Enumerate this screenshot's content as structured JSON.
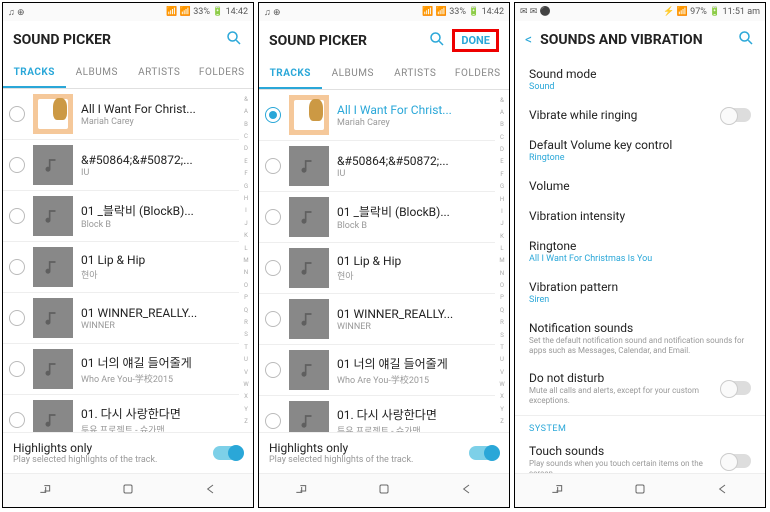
{
  "status1": {
    "left": "♫ ⊕",
    "right": "📶 📶 33% 🔋 14:42"
  },
  "status3": {
    "left": "✉ ✉ ⚫",
    "right": "⚡ 📶 97% 🔋 11:51 am"
  },
  "screen1": {
    "title": "SOUND PICKER",
    "tabs": [
      "TRACKS",
      "ALBUMS",
      "ARTISTS",
      "FOLDERS"
    ],
    "tracks": [
      {
        "title": "All I Want For Christ...",
        "artist": "Mariah Carey",
        "cover": true,
        "selected": false
      },
      {
        "title": "&#50864;&#50872;...",
        "artist": "IU"
      },
      {
        "title": "01 _블락비 (BlockB)...",
        "artist": "Block B"
      },
      {
        "title": "01 Lip & Hip",
        "artist": "현아"
      },
      {
        "title": "01 WINNER_REALLY...",
        "artist": "WINNER"
      },
      {
        "title": "01 너의 얘길 들어줄게",
        "artist": "Who Are You-学校2015"
      },
      {
        "title": "01. 다시 사랑한다면",
        "artist": "투유 프로젝트 - 슈가맨"
      }
    ],
    "highlights_title": "Highlights only",
    "highlights_sub": "Play selected highlights of the track."
  },
  "screen2": {
    "title": "SOUND PICKER",
    "done": "DONE",
    "tabs": [
      "TRACKS",
      "ALBUMS",
      "ARTISTS",
      "FOLDERS"
    ],
    "tracks": [
      {
        "title": "All I Want For Christ...",
        "artist": "Mariah Carey",
        "cover": true,
        "selected": true
      },
      {
        "title": "&#50864;&#50872;...",
        "artist": "IU"
      },
      {
        "title": "01 _블락비 (BlockB)...",
        "artist": "Block B"
      },
      {
        "title": "01 Lip & Hip",
        "artist": "현아"
      },
      {
        "title": "01 WINNER_REALLY...",
        "artist": "WINNER"
      },
      {
        "title": "01 너의 얘길 들어줄게",
        "artist": "Who Are You-学校2015"
      },
      {
        "title": "01. 다시 사랑한다면",
        "artist": "투유 프로젝트 - 슈가맨"
      }
    ],
    "highlights_title": "Highlights only",
    "highlights_sub": "Play selected highlights of the track."
  },
  "screen3": {
    "title": "SOUNDS AND VIBRATION",
    "items": [
      {
        "label": "Sound mode",
        "value": "Sound"
      },
      {
        "label": "Vibrate while ringing",
        "toggle": "off"
      },
      {
        "label": "Default Volume key control",
        "value": "Ringtone"
      },
      {
        "label": "Volume"
      },
      {
        "label": "Vibration intensity"
      },
      {
        "label": "Ringtone",
        "value": "All I Want For Christmas Is You"
      },
      {
        "label": "Vibration pattern",
        "value": "Siren"
      },
      {
        "label": "Notification sounds",
        "desc": "Set the default notification sound and notification sounds for apps such as Messages, Calendar, and Email."
      },
      {
        "label": "Do not disturb",
        "desc": "Mute all calls and alerts, except for your custom exceptions.",
        "toggle": "off"
      },
      {
        "section": "SYSTEM"
      },
      {
        "label": "Touch sounds",
        "desc": "Play sounds when you touch certain items on the screen.",
        "toggle": "off"
      }
    ]
  },
  "alpha": [
    "&",
    "A",
    "B",
    "C",
    "D",
    "E",
    "F",
    "G",
    "H",
    "I",
    "J",
    "K",
    "L",
    "M",
    "N",
    "O",
    "P",
    "Q",
    "R",
    "S",
    "T",
    "U",
    "V",
    "W",
    "X",
    "Y",
    "Z"
  ]
}
